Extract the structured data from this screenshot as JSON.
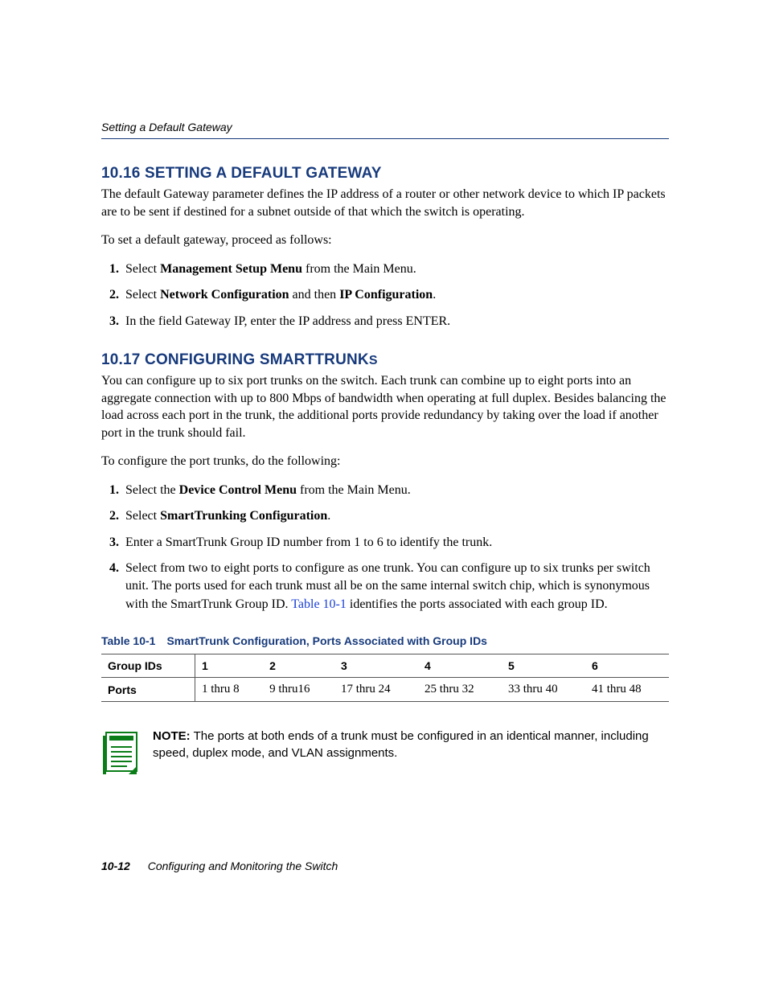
{
  "running_head": "Setting a Default Gateway",
  "section1": {
    "number": "10.16",
    "title": "SETTING A DEFAULT GATEWAY",
    "para1": "The default Gateway parameter defines the IP address of a router or other network device to which IP packets are to be sent if destined for a subnet outside of that which the switch is operating.",
    "para2": "To set a default gateway, proceed as follows:",
    "steps": {
      "s1_pre": "Select ",
      "s1_bold": "Management Setup Menu",
      "s1_post": " from the Main Menu.",
      "s2_pre": "Select ",
      "s2_bold1": "Network Configuration",
      "s2_mid": " and then ",
      "s2_bold2": "IP Configuration",
      "s2_post": ".",
      "s3": "In the field Gateway IP, enter the IP address and press ENTER."
    }
  },
  "section2": {
    "number": "10.17",
    "title_main": "CONFIGURING SMARTTRUNK",
    "title_sc": "S",
    "para1": "You can configure up to six port trunks on the switch. Each trunk can combine up to eight ports into an aggregate connection with up to 800 Mbps of bandwidth when operating at full duplex. Besides balancing the load across each port in the trunk, the additional ports provide redundancy by taking over the load if another port in the trunk should fail.",
    "para2": "To configure the port trunks, do the following:",
    "steps": {
      "s1_pre": "Select the ",
      "s1_bold": "Device Control Menu",
      "s1_post": " from the Main Menu.",
      "s2_pre": "Select ",
      "s2_bold": "SmartTrunking Configuration",
      "s2_post": ".",
      "s3": "Enter a SmartTrunk Group ID number from 1 to 6 to identify the trunk.",
      "s4_pre": "Select from two to eight ports to configure as one trunk. You can configure up to six trunks per switch unit. The ports used for each trunk must all be on the same internal switch chip, which is synonymous with the SmartTrunk Group ID. ",
      "s4_link": "Table 10-1",
      "s4_post": " identifies the ports associated with each group ID."
    }
  },
  "table": {
    "caption_label": "Table 10-1",
    "caption_title": "SmartTrunk Configuration, Ports Associated with Group IDs",
    "row_labels": {
      "groups": "Group IDs",
      "ports": "Ports"
    },
    "headers": [
      "1",
      "2",
      "3",
      "4",
      "5",
      "6"
    ],
    "ports": [
      "1 thru 8",
      "9 thru16",
      "17 thru 24",
      "25 thru 32",
      "33 thru 40",
      "41 thru 48"
    ]
  },
  "note": {
    "label": "NOTE:",
    "text": "  The ports at both ends of a trunk must be configured in an identical manner, including speed, duplex mode, and VLAN assignments."
  },
  "footer": {
    "page": "10-12",
    "chapter": "Configuring and Monitoring the Switch"
  }
}
